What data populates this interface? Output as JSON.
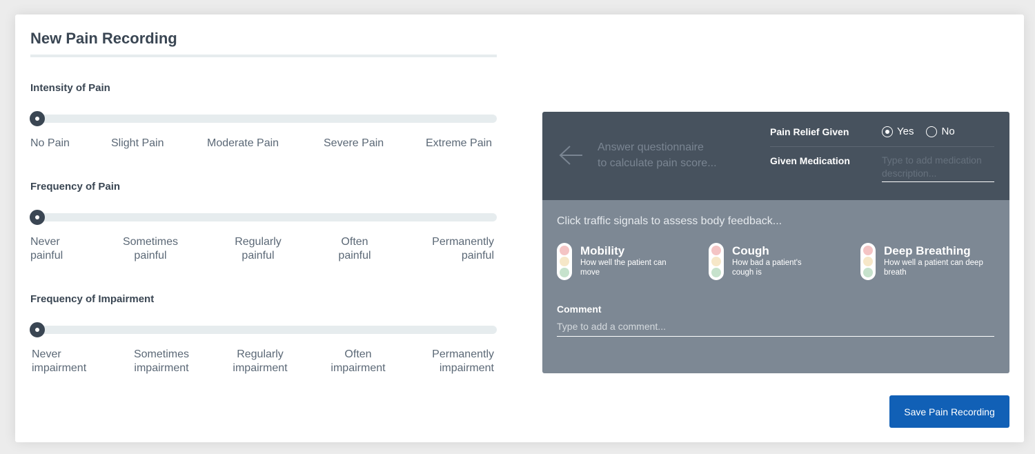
{
  "form": {
    "title": "New Pain Recording",
    "sections": [
      {
        "label": "Intensity of Pain",
        "value": 0,
        "options": [
          "No Pain",
          "Slight Pain",
          "Moderate Pain",
          "Severe Pain",
          "Extreme Pain"
        ]
      },
      {
        "label": "Frequency of Pain",
        "value": 0,
        "options": [
          {
            "line1": "Never",
            "line2": "painful"
          },
          {
            "line1": "Sometimes",
            "line2": "painful"
          },
          {
            "line1": "Regularly",
            "line2": "painful"
          },
          {
            "line1": "Often",
            "line2": "painful"
          },
          {
            "line1": "Permanently",
            "line2": "painful"
          }
        ]
      },
      {
        "label": "Frequency of Impairment",
        "value": 0,
        "options": [
          {
            "line1": "Never",
            "line2": "impairment"
          },
          {
            "line1": "Sometimes",
            "line2": "impairment"
          },
          {
            "line1": "Regularly",
            "line2": "impairment"
          },
          {
            "line1": "Often",
            "line2": "impairment"
          },
          {
            "line1": "Permanently",
            "line2": "impairment"
          }
        ]
      }
    ]
  },
  "panel": {
    "hint_line1": "Answer questionnaire",
    "hint_line2": "to calculate pain score...",
    "pain_relief_label": "Pain Relief Given",
    "radio_yes": "Yes",
    "radio_no": "No",
    "radio_selected": "Yes",
    "medication_label": "Given Medication",
    "medication_placeholder": "Type to add medication description...",
    "traffic_hint": "Click traffic signals to assess body feedback...",
    "signals": [
      {
        "title": "Mobility",
        "desc": "How well the patient can move"
      },
      {
        "title": "Cough",
        "desc": "How bad a patient's cough is"
      },
      {
        "title": "Deep Breathing",
        "desc": "How well a patient can deep breath"
      }
    ],
    "comment_label": "Comment",
    "comment_placeholder": "Type to add a comment..."
  },
  "actions": {
    "save_label": "Save Pain Recording"
  },
  "colors": {
    "accent": "#1160b6",
    "signal_red": "#f4c4c4",
    "signal_yellow": "#f6e7c8",
    "signal_green": "#c6e2cc"
  }
}
